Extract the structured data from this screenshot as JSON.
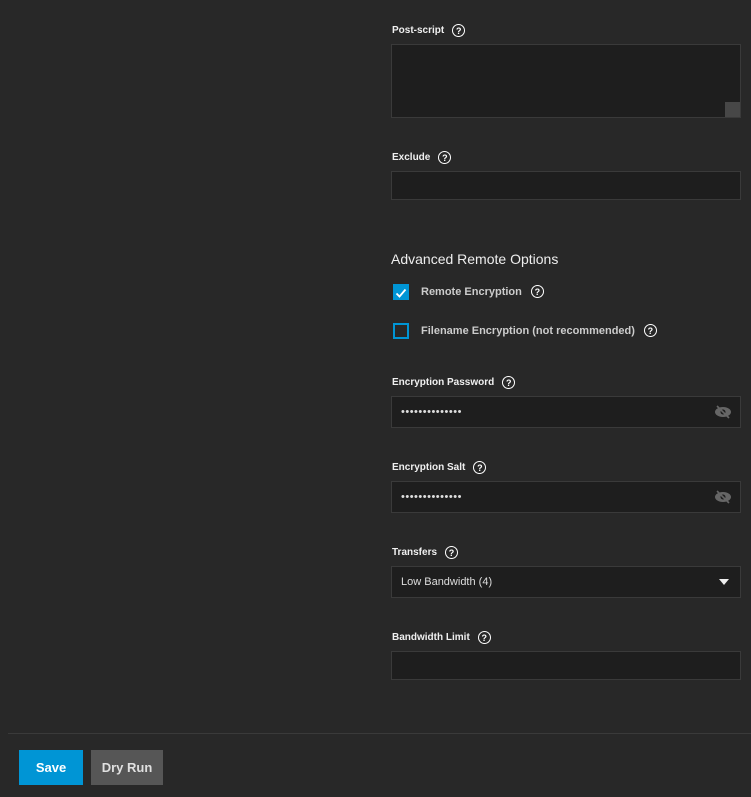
{
  "post_script": {
    "label": "Post-script",
    "value": ""
  },
  "exclude": {
    "label": "Exclude",
    "value": ""
  },
  "advanced": {
    "heading": "Advanced Remote Options",
    "remote_encryption": {
      "label": "Remote Encryption",
      "checked": true
    },
    "filename_encryption": {
      "label": "Filename Encryption (not recommended)",
      "checked": false
    }
  },
  "encryption_password": {
    "label": "Encryption Password",
    "value": "••••••••••••••"
  },
  "encryption_salt": {
    "label": "Encryption Salt",
    "value": "••••••••••••••"
  },
  "transfers": {
    "label": "Transfers",
    "value": "Low Bandwidth (4)"
  },
  "bandwidth_limit": {
    "label": "Bandwidth Limit",
    "value": ""
  },
  "actions": {
    "save": "Save",
    "dry_run": "Dry Run"
  },
  "help_glyph": "?",
  "colors": {
    "primary": "#0095d5",
    "secondary": "#565656"
  }
}
